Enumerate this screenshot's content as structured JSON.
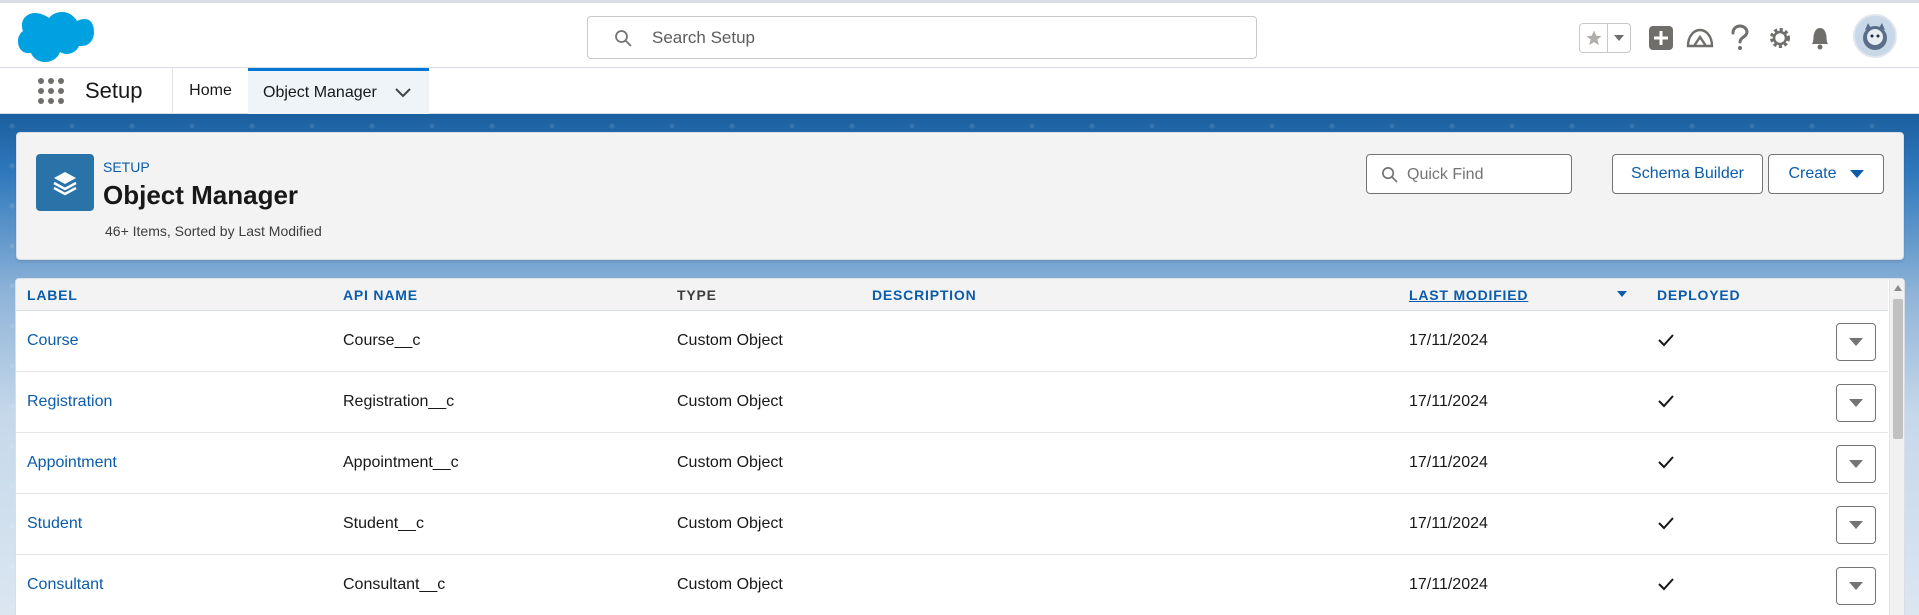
{
  "header": {
    "search_placeholder": "Search Setup",
    "brand_color": "#00a1e0"
  },
  "nav": {
    "app_name": "Setup",
    "tabs": [
      {
        "label": "Home"
      },
      {
        "label": "Object Manager"
      }
    ]
  },
  "page_header": {
    "eyebrow": "SETUP",
    "title": "Object Manager",
    "meta": "46+ Items, Sorted by Last Modified",
    "quick_find_placeholder": "Quick Find",
    "schema_builder_label": "Schema Builder",
    "create_label": "Create"
  },
  "table": {
    "columns": {
      "label": "LABEL",
      "api_name": "API NAME",
      "type": "TYPE",
      "description": "DESCRIPTION",
      "last_modified": "LAST MODIFIED",
      "deployed": "DEPLOYED"
    },
    "rows": [
      {
        "label": "Course",
        "api_name": "Course__c",
        "type": "Custom Object",
        "description": "",
        "last_modified": "17/11/2024",
        "deployed": true
      },
      {
        "label": "Registration",
        "api_name": "Registration__c",
        "type": "Custom Object",
        "description": "",
        "last_modified": "17/11/2024",
        "deployed": true
      },
      {
        "label": "Appointment",
        "api_name": "Appointment__c",
        "type": "Custom Object",
        "description": "",
        "last_modified": "17/11/2024",
        "deployed": true
      },
      {
        "label": "Student",
        "api_name": "Student__c",
        "type": "Custom Object",
        "description": "",
        "last_modified": "17/11/2024",
        "deployed": true
      },
      {
        "label": "Consultant",
        "api_name": "Consultant__c",
        "type": "Custom Object",
        "description": "",
        "last_modified": "17/11/2024",
        "deployed": true
      }
    ]
  }
}
